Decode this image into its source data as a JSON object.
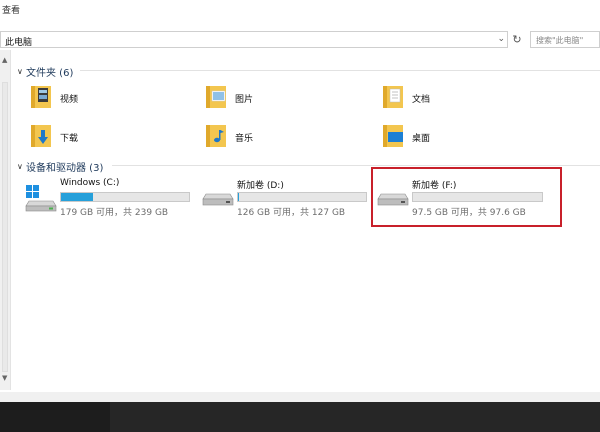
{
  "window": {
    "menu_label": "查看"
  },
  "address_bar": {
    "path": "此电脑",
    "dropdown_icon": "chevron-down-icon",
    "refresh_icon": "refresh-icon"
  },
  "search": {
    "placeholder": "搜索\"此电脑\""
  },
  "groups": {
    "folders": {
      "title": "文件夹 (6)",
      "items": [
        {
          "label": "视频",
          "icon": "videos-folder-icon"
        },
        {
          "label": "图片",
          "icon": "pictures-folder-icon"
        },
        {
          "label": "文档",
          "icon": "documents-folder-icon"
        },
        {
          "label": "下载",
          "icon": "downloads-folder-icon"
        },
        {
          "label": "音乐",
          "icon": "music-folder-icon"
        },
        {
          "label": "桌面",
          "icon": "desktop-folder-icon"
        }
      ]
    },
    "drives": {
      "title": "设备和驱动器 (3)",
      "items": [
        {
          "name": "Windows (C:)",
          "info": "179 GB 可用，共 239 GB",
          "used_fraction": 0.25,
          "icon": "system-drive-icon"
        },
        {
          "name": "新加卷 (D:)",
          "info": "126 GB 可用，共 127 GB",
          "used_fraction": 0.01,
          "icon": "hard-drive-icon"
        },
        {
          "name": "新加卷 (F:)",
          "info": "97.5 GB 可用，共 97.6 GB",
          "used_fraction": 0.0,
          "icon": "hard-drive-icon"
        }
      ]
    }
  },
  "colors": {
    "accent": "#26a0da",
    "highlight_border": "#c8202a",
    "folder_yellow": "#f3c64f",
    "header_text": "#1e395b"
  }
}
